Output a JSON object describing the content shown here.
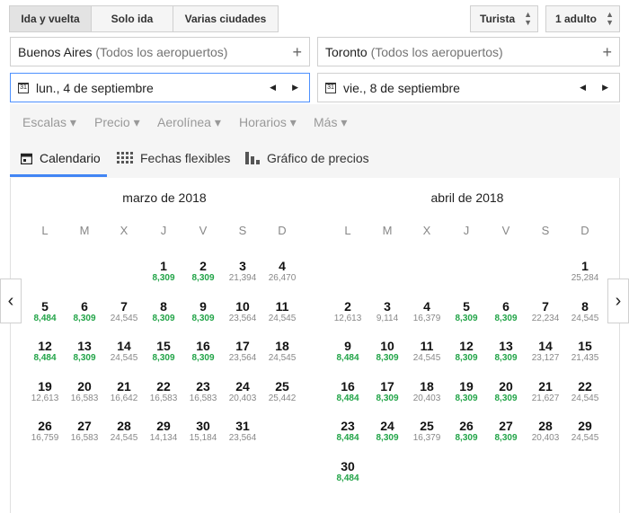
{
  "trip_types": [
    {
      "label": "Ida y vuelta",
      "active": true,
      "w": 92
    },
    {
      "label": "Solo ida",
      "active": false,
      "w": 92
    },
    {
      "label": "Varias ciudades",
      "active": false,
      "w": 118
    }
  ],
  "cabin": "Turista",
  "passengers": "1 adulto",
  "origin": {
    "city": "Buenos Aires",
    "airports": "(Todos los aeropuertos)"
  },
  "destination": {
    "city": "Toronto",
    "airports": "(Todos los aeropuertos)"
  },
  "depart_date": "lun., 4 de septiembre",
  "return_date": "vie., 8 de septiembre",
  "calendar_icon_number": "31",
  "plus_symbol": "+",
  "filters": [
    "Escalas",
    "Precio",
    "Aerolínea",
    "Horarios",
    "Más"
  ],
  "tabs": [
    {
      "label": "Calendario",
      "icon": "calendar-icon",
      "active": true
    },
    {
      "label": "Fechas flexibles",
      "icon": "grid-icon",
      "active": false
    },
    {
      "label": "Gráfico de precios",
      "icon": "bar-chart-icon",
      "active": false
    }
  ],
  "weekdays": [
    "L",
    "M",
    "X",
    "J",
    "V",
    "S",
    "D"
  ],
  "low_price_color": "#22a448",
  "months": [
    {
      "title": "marzo de 2018",
      "first_weekday": 3,
      "days": [
        [
          "1",
          "8,309"
        ],
        [
          "2",
          "8,309"
        ],
        [
          "3",
          "21,394"
        ],
        [
          "4",
          "26,470"
        ],
        [
          "5",
          "8,484"
        ],
        [
          "6",
          "8,309"
        ],
        [
          "7",
          "24,545"
        ],
        [
          "8",
          "8,309"
        ],
        [
          "9",
          "8,309"
        ],
        [
          "10",
          "23,564"
        ],
        [
          "11",
          "24,545"
        ],
        [
          "12",
          "8,484"
        ],
        [
          "13",
          "8,309"
        ],
        [
          "14",
          "24,545"
        ],
        [
          "15",
          "8,309"
        ],
        [
          "16",
          "8,309"
        ],
        [
          "17",
          "23,564"
        ],
        [
          "18",
          "24,545"
        ],
        [
          "19",
          "12,613"
        ],
        [
          "20",
          "16,583"
        ],
        [
          "21",
          "16,642"
        ],
        [
          "22",
          "16,583"
        ],
        [
          "23",
          "16,583"
        ],
        [
          "24",
          "20,403"
        ],
        [
          "25",
          "25,442"
        ],
        [
          "26",
          "16,759"
        ],
        [
          "27",
          "16,583"
        ],
        [
          "28",
          "24,545"
        ],
        [
          "29",
          "14,134"
        ],
        [
          "30",
          "15,184"
        ],
        [
          "31",
          "23,564"
        ]
      ]
    },
    {
      "title": "abril de 2018",
      "first_weekday": 6,
      "days": [
        [
          "1",
          "25,284"
        ],
        [
          "2",
          "12,613"
        ],
        [
          "3",
          "9,114"
        ],
        [
          "4",
          "16,379"
        ],
        [
          "5",
          "8,309"
        ],
        [
          "6",
          "8,309"
        ],
        [
          "7",
          "22,234"
        ],
        [
          "8",
          "24,545"
        ],
        [
          "9",
          "8,484"
        ],
        [
          "10",
          "8,309"
        ],
        [
          "11",
          "24,545"
        ],
        [
          "12",
          "8,309"
        ],
        [
          "13",
          "8,309"
        ],
        [
          "14",
          "23,127"
        ],
        [
          "15",
          "21,435"
        ],
        [
          "16",
          "8,484"
        ],
        [
          "17",
          "8,309"
        ],
        [
          "18",
          "20,403"
        ],
        [
          "19",
          "8,309"
        ],
        [
          "20",
          "8,309"
        ],
        [
          "21",
          "21,627"
        ],
        [
          "22",
          "24,545"
        ],
        [
          "23",
          "8,484"
        ],
        [
          "24",
          "8,309"
        ],
        [
          "25",
          "16,379"
        ],
        [
          "26",
          "8,309"
        ],
        [
          "27",
          "8,309"
        ],
        [
          "28",
          "20,403"
        ],
        [
          "29",
          "24,545"
        ],
        [
          "30",
          "8,484"
        ]
      ]
    }
  ],
  "low_prices": [
    "8,309",
    "8,484"
  ]
}
